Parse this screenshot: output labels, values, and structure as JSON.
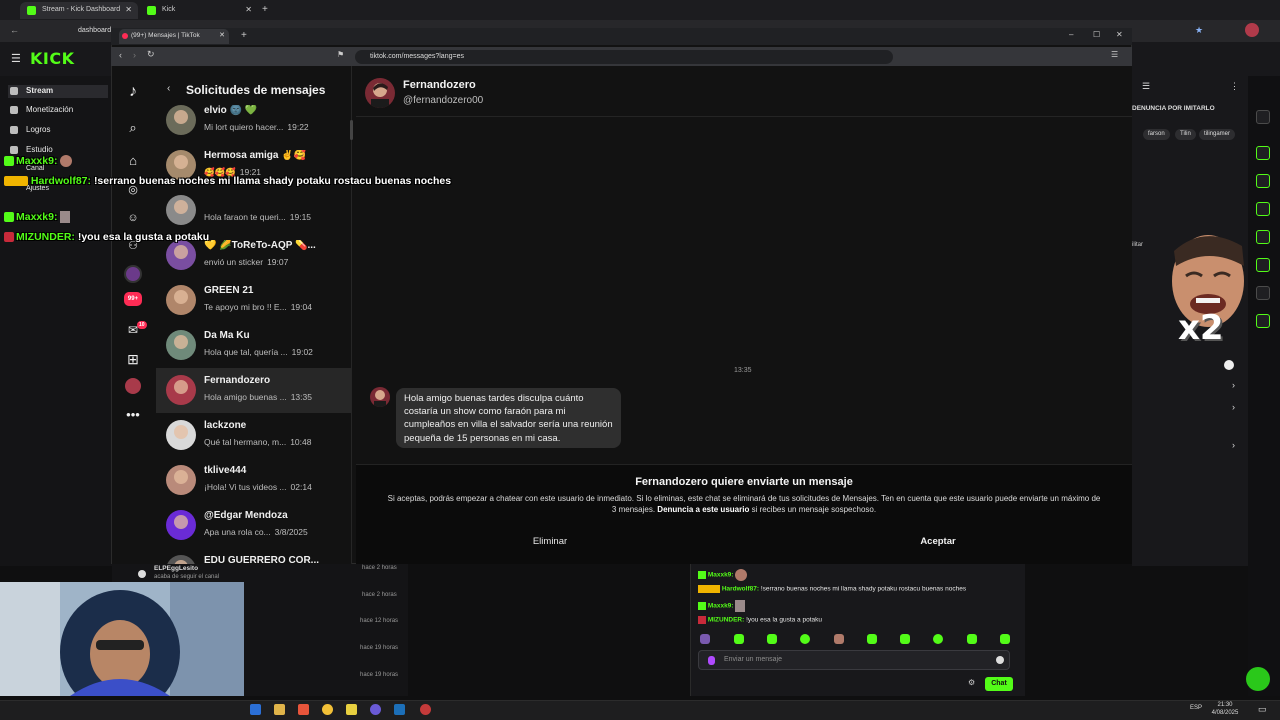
{
  "outer_browser": {
    "tabs": [
      {
        "label": "Stream - Kick Dashboard",
        "active": true
      },
      {
        "label": "Kick",
        "active": false
      }
    ],
    "address_text": "dashboard"
  },
  "kick": {
    "logo": "KICK",
    "sidebar": [
      {
        "label": "Stream",
        "active": true
      },
      {
        "label": "Monetización"
      },
      {
        "label": "Logros"
      },
      {
        "label": "Estudio"
      },
      {
        "label": "Canal"
      },
      {
        "label": "Ajustes"
      }
    ],
    "right_panel": {
      "report_label": "DENUNCIA POR IMITARLO",
      "chips": [
        "farson",
        "Tilin",
        "tilingamer"
      ],
      "side_label": "ilitar"
    },
    "overlay_chat": [
      {
        "user": "Maxxk9:",
        "text": ""
      },
      {
        "user": "Hardwolf87:",
        "text": "!serrano buenas noches mi llama shady potaku rostacu buenas noches"
      },
      {
        "user": "Maxxk9:",
        "text": ""
      },
      {
        "user": "MIZUNDER:",
        "text": "!you esa la gusta a potaku"
      }
    ],
    "activity": {
      "top_user": "ELPEggLesito",
      "top_text": "acaba de seguir el canal",
      "times": [
        "hace 2 horas",
        "hace 2 horas",
        "hace 12 horas",
        "hace 19 horas",
        "hace 19 horas"
      ]
    },
    "chat_panel": {
      "lines": [
        {
          "user": "Maxxk9:",
          "text": ""
        },
        {
          "user": "Hardwolf87:",
          "text": "!serrano buenas noches mi llama shady potaku rostacu buenas noches"
        },
        {
          "user": "Maxxk9:",
          "text": ""
        },
        {
          "user": "MIZUNDER:",
          "text": "!you esa la gusta a potaku"
        }
      ],
      "input_placeholder": "Enviar un mensaje",
      "send_label": "Chat"
    },
    "meme_text": "x2"
  },
  "inner_browser": {
    "tab_label": "(99+) Mensajes | TikTok",
    "url": "tiktok.com/messages?lang=es",
    "rail_badges": {
      "explore": "99+",
      "inbox": "10"
    }
  },
  "tiktok": {
    "panel_title": "Solicitudes de mensajes",
    "requests": [
      {
        "name": "elvio 🌚 💚",
        "preview": "Mi lort quiero hacer...",
        "time": "19:22",
        "color": "#6b6b5a"
      },
      {
        "name": "Hermosa amiga ✌️🥰",
        "preview": "🥰🥰🥰",
        "time": "19:21",
        "color": "#a58a6c"
      },
      {
        "name": "",
        "preview": "Hola faraon te queri...",
        "time": "19:15",
        "color": "#8a8a8a"
      },
      {
        "name": "💛 🌽ToReTo-AQP 💊...",
        "preview": "envió un sticker",
        "time": "19:07",
        "color": "#7a4ea1"
      },
      {
        "name": "GREEN 21",
        "preview": "Te apoyo mi bro !! E...",
        "time": "19:04",
        "color": "#b0866a"
      },
      {
        "name": "Da Ma Ku",
        "preview": "Hola que tal, quería ...",
        "time": "19:02",
        "color": "#6f8a7a"
      },
      {
        "name": "Fernandozero",
        "preview": "Hola amigo buenas ...",
        "time": "13:35",
        "color": "#a83a4a",
        "selected": true
      },
      {
        "name": "lackzone",
        "preview": "Qué tal hermano, m...",
        "time": "10:48",
        "color": "#d9d9d9"
      },
      {
        "name": "tklive444",
        "preview": "¡Hola! Vi tus videos ...",
        "time": "02:14",
        "color": "#b98a7a"
      },
      {
        "name": "@Edgar Mendoza",
        "preview": "Apa una rola co...",
        "time": "3/8/2025",
        "color": "#6a2bd6"
      },
      {
        "name": "EDU GUERRERO COR...",
        "preview": "",
        "time": "",
        "color": "#555"
      }
    ],
    "conversation": {
      "name": "Fernandozero",
      "handle": "@fernandozero00",
      "time": "13:35",
      "message": "Hola amigo buenas tardes disculpa cuánto costaría un show como faraón para mi cumpleaños en villa el salvador sería una reunión pequeña de 15 personas en mi casa."
    },
    "request_prompt": {
      "title": "Fernandozero quiere enviarte un mensaje",
      "text_before": "Si aceptas, podrás empezar a chatear con este usuario de inmediato. Si lo eliminas, este chat se eliminará de tus solicitudes de Mensajes. Ten en cuenta que este usuario puede enviarte un máximo de 3 mensajes.",
      "report_link": "Denuncia a este usuario",
      "text_after": "si recibes un mensaje sospechoso.",
      "delete_label": "Eliminar",
      "accept_label": "Aceptar"
    }
  },
  "taskbar": {
    "time": "21:30",
    "date": "4/08/2025",
    "lang": "ESP"
  },
  "colors": {
    "kick_green": "#53fc18",
    "tiktok_red": "#fe2c55"
  }
}
